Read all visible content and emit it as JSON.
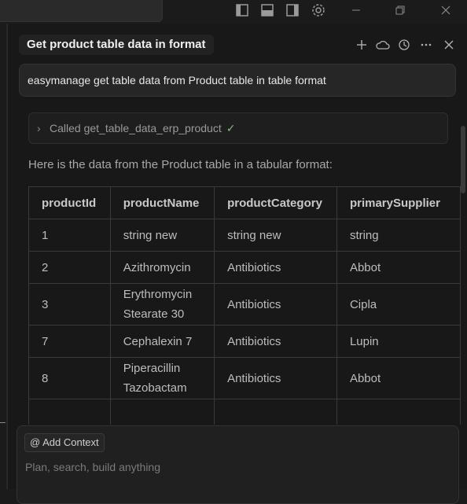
{
  "window": {
    "icons": [
      "sidebar-left-icon",
      "panel-bottom-icon",
      "sidebar-right-icon",
      "gear-icon",
      "minimize-icon",
      "restore-icon",
      "close-icon"
    ]
  },
  "chat": {
    "title": "Get product table data in format",
    "header_icons": [
      "plus-icon",
      "cloud-icon",
      "history-icon",
      "more-icon",
      "close-icon"
    ],
    "user_message": "easymanage get table data from Product table in table format",
    "tool_call": "Called get_table_data_erp_product",
    "tool_status": "✓",
    "intro": "Here is the data from the Product table in a tabular format:"
  },
  "table": {
    "headers": [
      "productId",
      "productName",
      "productCategory",
      "primarySupplier"
    ],
    "rows": [
      [
        "1",
        "string new",
        "string new",
        "string"
      ],
      [
        "2",
        "Azithromycin",
        "Antibiotics",
        "Abbot"
      ],
      [
        "3",
        "Erythromycin Stearate 30",
        "Antibiotics",
        "Cipla"
      ],
      [
        "7",
        "Cephalexin 7",
        "Antibiotics",
        "Lupin"
      ],
      [
        "8",
        "Piperacillin Tazobactam",
        "Antibiotics",
        "Abbot"
      ]
    ]
  },
  "composer": {
    "context_label": "Add Context",
    "context_icon": "@",
    "placeholder": "Plan, search, build anything"
  }
}
